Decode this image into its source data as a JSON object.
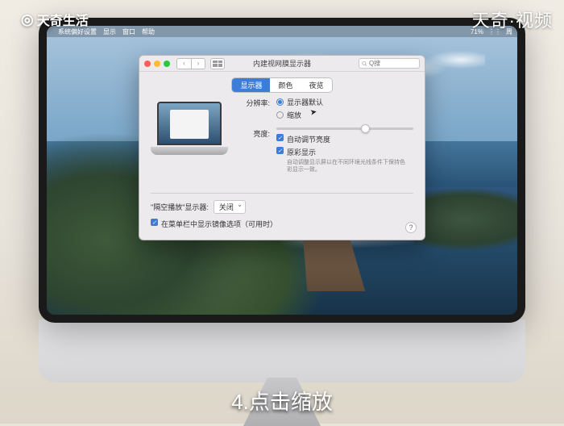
{
  "watermarks": {
    "top_left": "天奇生活",
    "top_right": "天奇·视频"
  },
  "subtitle": "4.点击缩放",
  "menubar": {
    "apple": "",
    "app": "系统偏好设置",
    "menus": [
      "显示",
      "窗口",
      "帮助"
    ],
    "clock": "周",
    "battery": "71%"
  },
  "panel": {
    "title": "内建视网膜显示器",
    "search_placeholder": "Q搜",
    "tabs": {
      "display": "显示器",
      "color": "颜色",
      "nightshift": "夜览"
    },
    "resolution": {
      "label": "分辨率:",
      "default": "显示器默认",
      "scaled": "缩放"
    },
    "brightness": {
      "label": "亮度:",
      "auto": "自动调节亮度",
      "truetone": "原彩显示",
      "truetone_hint1": "自动调整显示屏以在不同环境光线条件下保持色",
      "truetone_hint2": "彩显示一致。"
    },
    "airplay": {
      "label": "\"隔空播放\"显示器:",
      "value": "关闭"
    },
    "showmenu": "在菜单栏中显示镜像选项（可用时）",
    "help": "?"
  }
}
